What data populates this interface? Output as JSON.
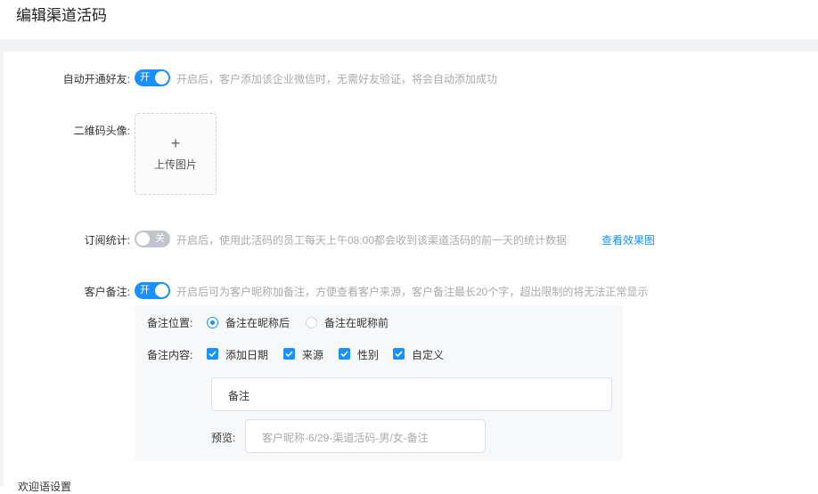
{
  "page_title": "编辑渠道活码",
  "auto_friend": {
    "label": "自动开通好友:",
    "switch_text": "开",
    "enabled": true,
    "hint": "开启后，客户添加该企业微信时，无需好友验证，将会自动添加成功"
  },
  "qr_avatar": {
    "label": "二维码头像:",
    "upload_icon": "+",
    "upload_text": "上传图片"
  },
  "subscribe_stats": {
    "label": "订阅统计:",
    "switch_text": "关",
    "enabled": false,
    "hint": "开启后，使用此活码的员工每天上午08:00都会收到该渠道活码的前一天的统计数据",
    "link": "查看效果图"
  },
  "customer_remark": {
    "label": "客户备注:",
    "switch_text": "开",
    "enabled": true,
    "hint": "开启后可为客户昵称加备注，方便查看客户来源，客户备注最长20个字，超出限制的将无法正常显示",
    "position_label": "备注位置:",
    "position_options": [
      "备注在昵称后",
      "备注在昵称前"
    ],
    "position_selected": "备注在昵称后",
    "content_label": "备注内容:",
    "content_options": [
      "添加日期",
      "来源",
      "性别",
      "自定义"
    ],
    "content_checked": [
      "添加日期",
      "来源",
      "性别",
      "自定义"
    ],
    "custom_value": "备注",
    "preview_label": "预览:",
    "preview_value": "客户昵称-6/29-渠道活码-男/女-备注"
  },
  "next_section_label": "欢迎语设置"
}
